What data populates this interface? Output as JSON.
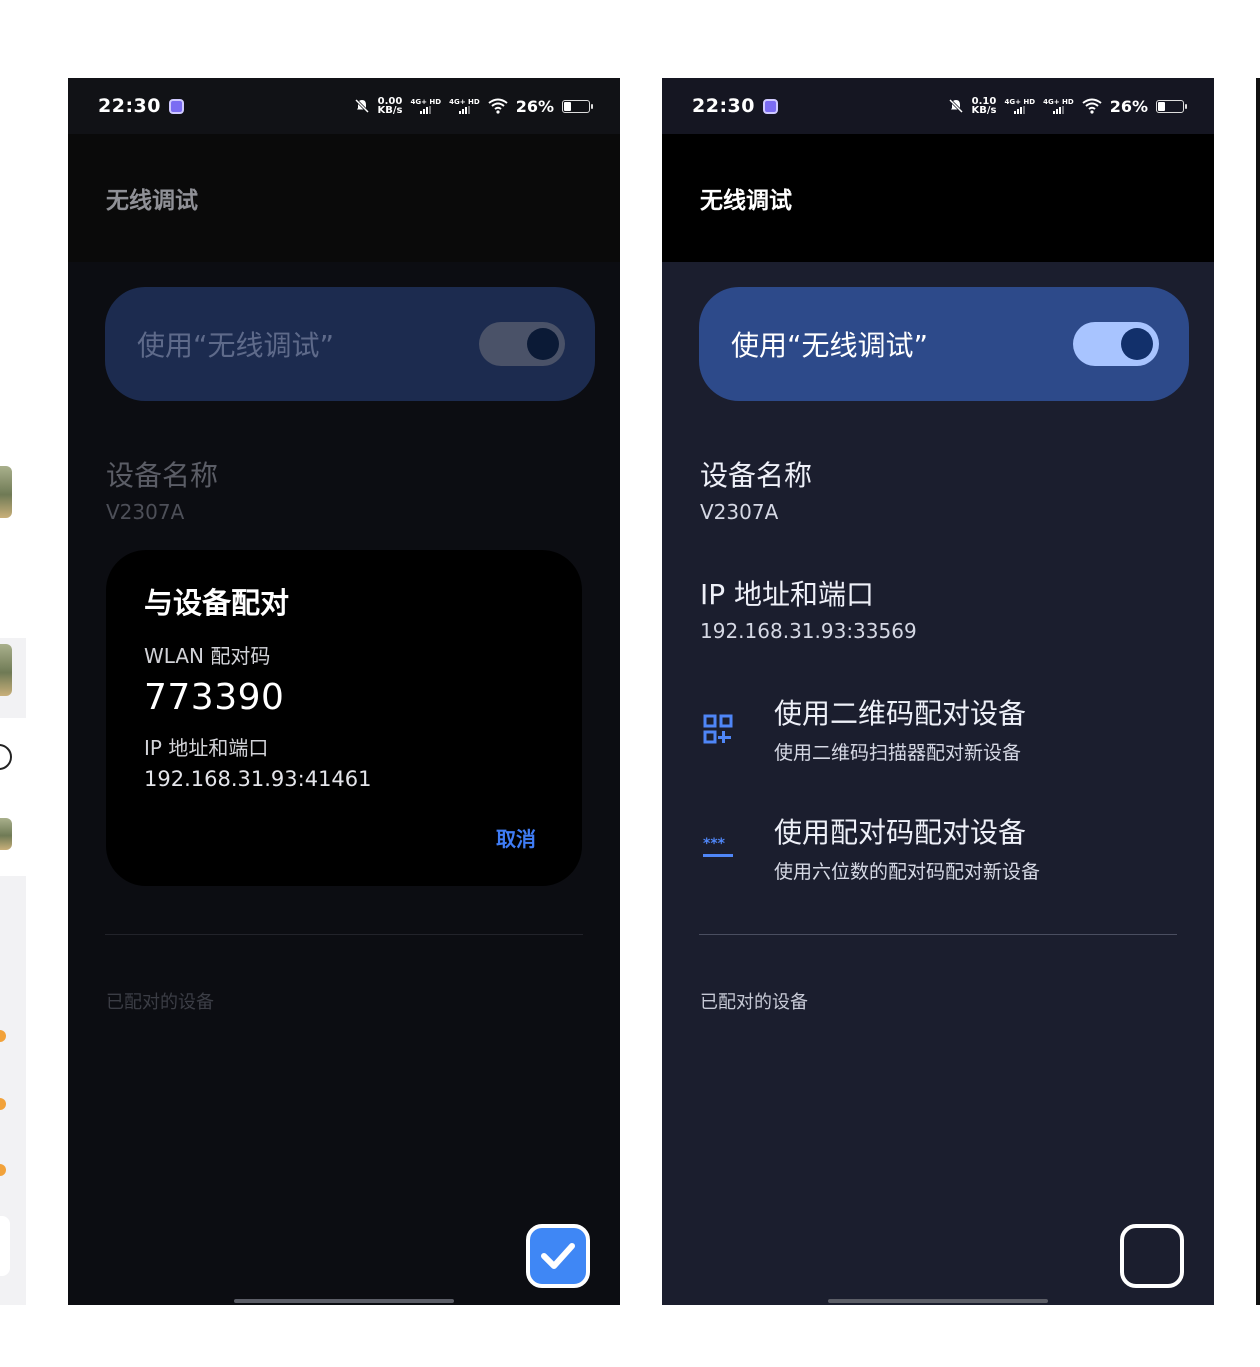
{
  "colors": {
    "accent": "#3f87f5",
    "toggle_card": "#2d4a8a",
    "switch_track": "#a8c4ff",
    "panel_bg": "#1b1e2e"
  },
  "status": {
    "time": "22:30",
    "net_left": [
      "0.00",
      "KB/s"
    ],
    "net_right": [
      "0.10",
      "KB/s"
    ],
    "sim1": "4G+ HD",
    "sim2": "4G+ HD",
    "battery": "26%",
    "battery_level": 0.26
  },
  "page": {
    "title": "无线调试",
    "toggle_label": "使用“无线调试”",
    "toggle_on": true,
    "device_name_title": "设备名称",
    "device_name_value": "V2307A",
    "ip_title": "IP 地址和端口",
    "ip_value": "192.168.31.93:33569",
    "qr_title": "使用二维码配对设备",
    "qr_sub": "使用二维码扫描器配对新设备",
    "code_title": "使用配对码配对设备",
    "code_sub": "使用六位数的配对码配对新设备",
    "paired_section": "已配对的设备"
  },
  "dialog": {
    "title": "与设备配对",
    "wlan_label": "WLAN 配对码",
    "wlan_code": "773390",
    "ip_label": "IP 地址和端口",
    "ip_value": "192.168.31.93:41461",
    "cancel": "取消"
  },
  "selection": {
    "left_checked": true,
    "right_checked": false
  },
  "icons": {
    "dnd": "bell-off-icon",
    "wifi": "wifi-icon",
    "qr": "qr-code-icon",
    "code": "pin-code-icon",
    "check": "check-icon"
  }
}
